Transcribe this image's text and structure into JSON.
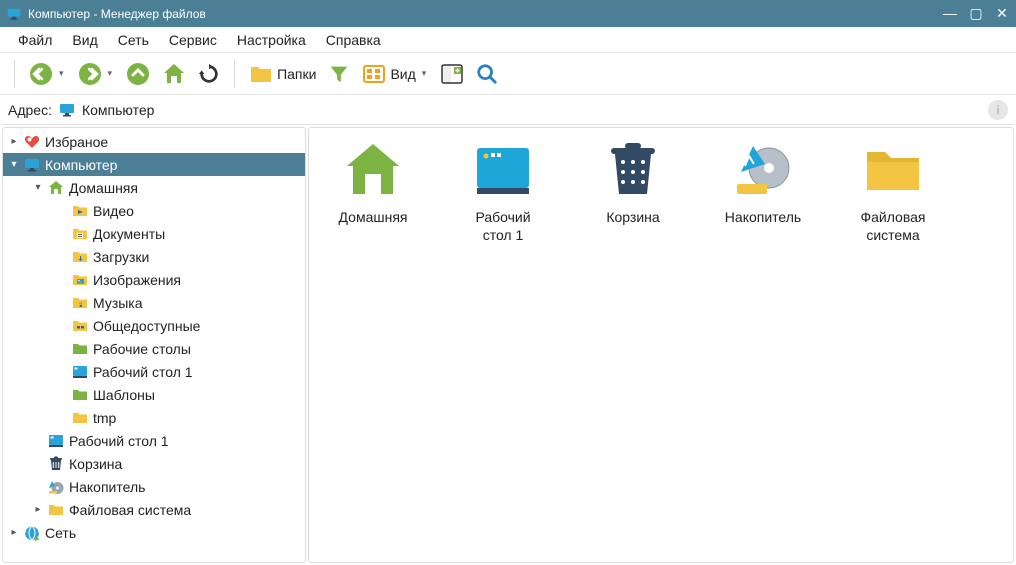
{
  "window": {
    "title": "Компьютер  - Менеджер файлов"
  },
  "menu": {
    "items": [
      "Файл",
      "Вид",
      "Сеть",
      "Сервис",
      "Настройка",
      "Справка"
    ]
  },
  "toolbar": {
    "folders": "Папки",
    "view": "Вид"
  },
  "address": {
    "label": "Адрес:",
    "path": "Компьютер"
  },
  "tree": {
    "favorites": {
      "label": "Избраное"
    },
    "computer": {
      "label": "Компьютер"
    },
    "home": {
      "label": "Домашняя"
    },
    "videos": {
      "label": "Видео"
    },
    "documents": {
      "label": "Документы"
    },
    "downloads": {
      "label": "Загрузки"
    },
    "pictures": {
      "label": "Изображения"
    },
    "music": {
      "label": "Музыка"
    },
    "public": {
      "label": "Общедоступные"
    },
    "desktops": {
      "label": "Рабочие столы"
    },
    "desktop1_in": {
      "label": "Рабочий стол 1"
    },
    "templates": {
      "label": "Шаблоны"
    },
    "tmp": {
      "label": "tmp"
    },
    "desktop1": {
      "label": "Рабочий стол 1"
    },
    "trash": {
      "label": "Корзина"
    },
    "storage": {
      "label": "Накопитель"
    },
    "filesystem": {
      "label": "Файловая система"
    },
    "network": {
      "label": "Сеть"
    }
  },
  "content": {
    "home": {
      "label": "Домашняя"
    },
    "desktop1": {
      "label": "Рабочий\nстол 1"
    },
    "trash": {
      "label": "Корзина"
    },
    "storage": {
      "label": "Накопитель"
    },
    "filesystem": {
      "label": "Файловая\nсистема"
    }
  }
}
